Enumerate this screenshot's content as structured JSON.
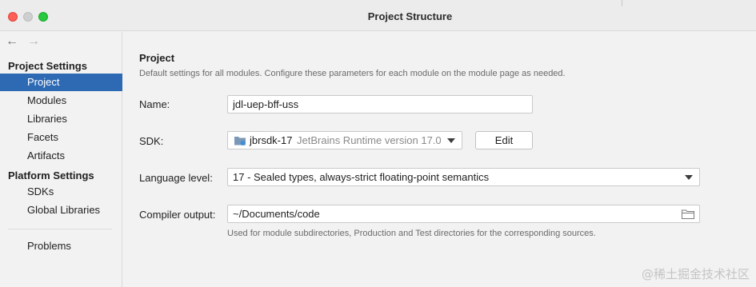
{
  "window": {
    "title": "Project Structure"
  },
  "sidebar": {
    "back_icon": "←",
    "forward_icon": "→",
    "project_settings_heading": "Project Settings",
    "project_items": [
      {
        "label": "Project",
        "selected": true
      },
      {
        "label": "Modules"
      },
      {
        "label": "Libraries"
      },
      {
        "label": "Facets"
      },
      {
        "label": "Artifacts"
      }
    ],
    "platform_settings_heading": "Platform Settings",
    "platform_items": [
      {
        "label": "SDKs"
      },
      {
        "label": "Global Libraries"
      }
    ],
    "other_items": [
      {
        "label": "Problems"
      }
    ]
  },
  "main": {
    "title": "Project",
    "description": "Default settings for all modules. Configure these parameters for each module on the module page as needed.",
    "name_label": "Name:",
    "name_value": "jdl-uep-bff-uss",
    "sdk_label": "SDK:",
    "sdk_name": "jbrsdk-17",
    "sdk_description": "JetBrains Runtime version 17.0",
    "edit_button": "Edit",
    "language_level_label": "Language level:",
    "language_level_value": "17 - Sealed types, always-strict floating-point semantics",
    "compiler_output_label": "Compiler output:",
    "compiler_output_value": "~/Documents/code",
    "compiler_output_hint": "Used for module subdirectories, Production and Test directories for the corresponding sources."
  },
  "watermark": "@稀土掘金技术社区",
  "colors": {
    "selection": "#2e6ab4",
    "background": "#f2f2f2"
  }
}
